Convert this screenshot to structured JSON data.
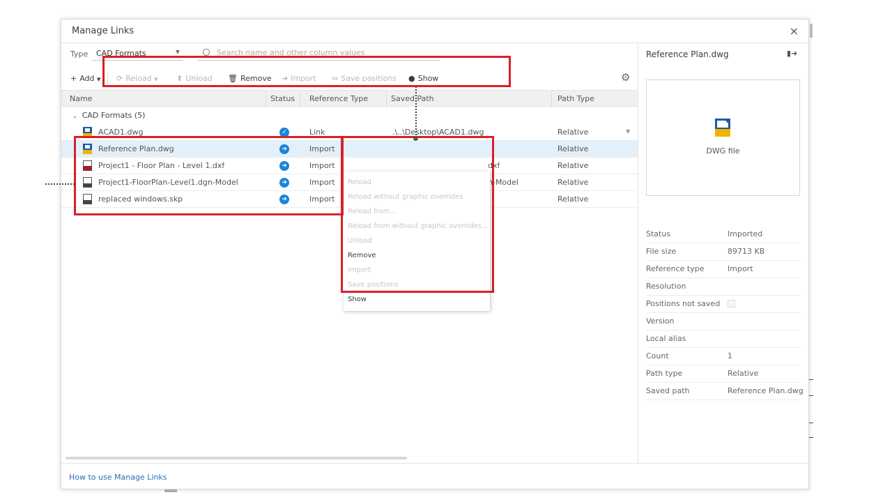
{
  "dialog": {
    "title": "Manage Links",
    "close_glyph": "×"
  },
  "filter": {
    "type_label": "Type",
    "type_value": "CAD Formats",
    "search_placeholder": "Search name and other column values"
  },
  "toolbar": {
    "add": "Add",
    "reload": "Reload",
    "unload": "Unload",
    "remove": "Remove",
    "import": "Import",
    "save_positions": "Save positions",
    "show": "Show"
  },
  "columns": [
    "Name",
    "Status",
    "Reference Type",
    "Saved Path",
    "Path Type"
  ],
  "group": {
    "label": "CAD Formats",
    "count": "(5)"
  },
  "rows": [
    {
      "name": "ACAD1.dwg",
      "status": "loaded",
      "reference_type": "Link",
      "saved_path": ".\\..\\Desktop\\ACAD1.dwg",
      "path_type": "Relative",
      "icon": "dwg-file-icon"
    },
    {
      "name": "Reference Plan.dwg",
      "status": "imported",
      "reference_type": "Import",
      "saved_path": "",
      "path_type": "Relative",
      "icon": "dwg-file-icon"
    },
    {
      "name": "Project1 - Floor Plan - Level 1.dxf",
      "status": "imported",
      "reference_type": "Import",
      "saved_path": "dxf",
      "path_type": "Relative",
      "icon": "dxf-file-icon"
    },
    {
      "name": "Project1-FloorPlan-Level1.dgn-Model",
      "status": "imported",
      "reference_type": "Import",
      "saved_path": "n-Model",
      "path_type": "Relative",
      "icon": "dgn-file-icon"
    },
    {
      "name": "replaced windows.skp",
      "status": "imported",
      "reference_type": "Import",
      "saved_path": "",
      "path_type": "Relative",
      "icon": "skp-file-icon"
    }
  ],
  "context_menu": [
    {
      "label": "Reload",
      "enabled": false
    },
    {
      "label": "Reload without graphic overrides",
      "enabled": false
    },
    {
      "label": "Reload from...",
      "enabled": false
    },
    {
      "label": "Reload from without graphic overrides...",
      "enabled": false
    },
    {
      "label": "Unload",
      "enabled": false
    },
    {
      "label": "Remove",
      "enabled": true
    },
    {
      "label": "Import",
      "enabled": false
    },
    {
      "label": "Save positions",
      "enabled": false
    },
    {
      "label": "Show",
      "enabled": true
    }
  ],
  "details": {
    "title": "Reference Plan.dwg",
    "preview_caption": "DWG file",
    "properties": [
      {
        "label": "Status",
        "value": "Imported"
      },
      {
        "label": "File size",
        "value": "89713 KB"
      },
      {
        "label": "Reference type",
        "value": "Import"
      },
      {
        "label": "Resolution",
        "value": ""
      },
      {
        "label": "Positions not saved",
        "value": "",
        "checkbox": true
      },
      {
        "label": "Version",
        "value": ""
      },
      {
        "label": "Local alias",
        "value": ""
      },
      {
        "label": "Count",
        "value": "1"
      },
      {
        "label": "Path type",
        "value": "Relative"
      },
      {
        "label": "Saved path",
        "value": "Reference Plan.dwg"
      }
    ]
  },
  "footer": {
    "help_link": "How to use Manage Links"
  },
  "colors": {
    "highlight": "#d9202a",
    "accent": "#1a86d9",
    "selected_row": "#e3f0fa",
    "link": "#2a6fb4"
  }
}
